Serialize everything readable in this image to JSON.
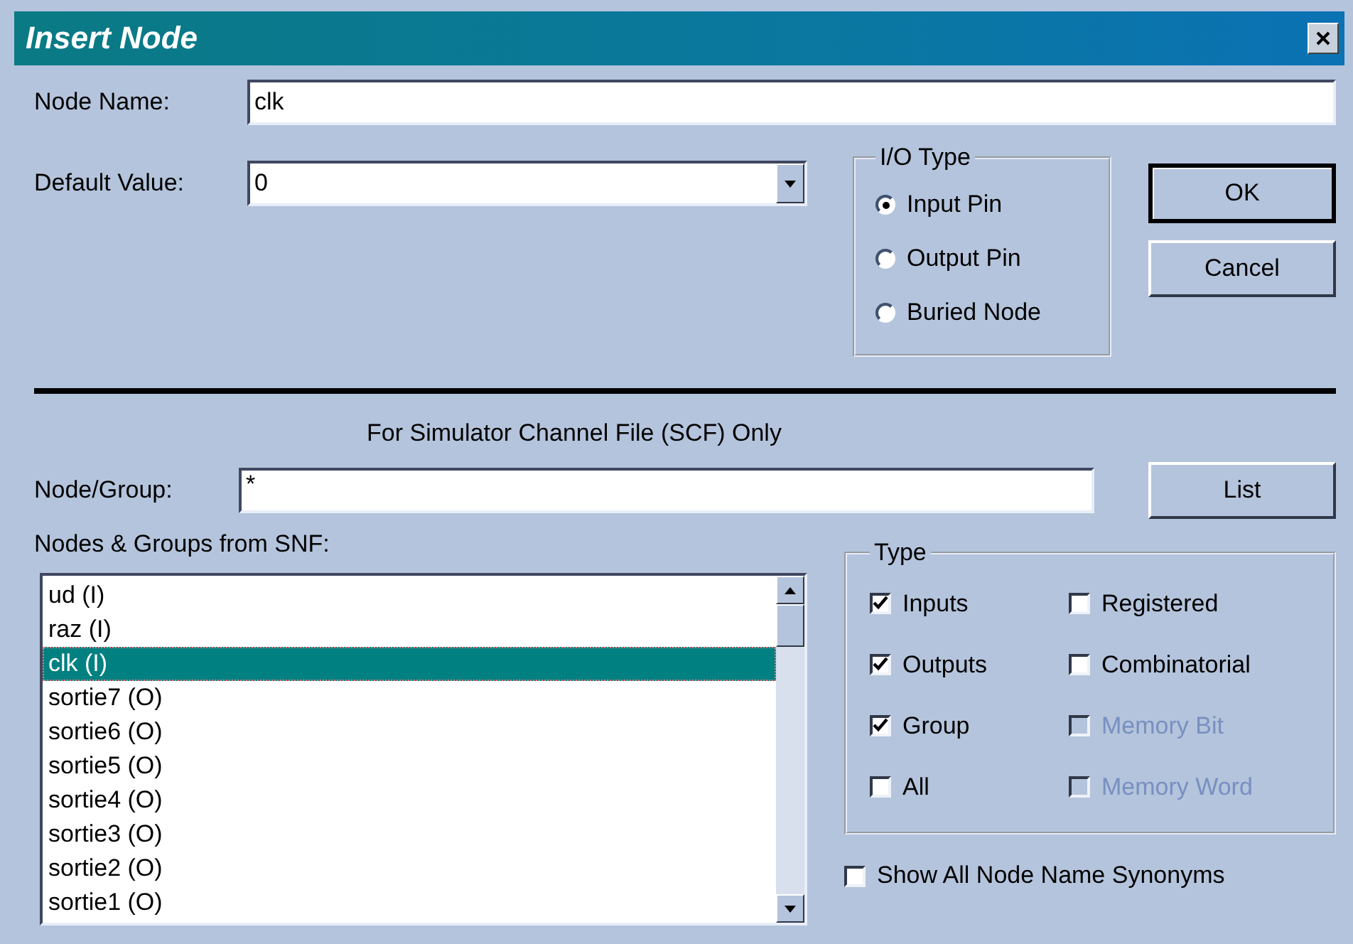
{
  "window": {
    "title": "Insert Node"
  },
  "node_name": {
    "label": "Node Name:",
    "value": "clk"
  },
  "default_value": {
    "label": "Default Value:",
    "value": "0"
  },
  "io_type": {
    "label": "I/O Type",
    "options": [
      {
        "label": "Input Pin",
        "selected": true
      },
      {
        "label": "Output Pin",
        "selected": false
      },
      {
        "label": "Buried Node",
        "selected": false
      }
    ]
  },
  "buttons": [
    {
      "label": "OK",
      "default": true
    },
    {
      "label": "Cancel",
      "default": false
    }
  ],
  "section_caption": "For Simulator Channel File (SCF) Only",
  "node_group": {
    "label": "Node/Group:",
    "value": "*"
  },
  "list_button": {
    "label": "List"
  },
  "nodes_list": {
    "label": "Nodes & Groups from SNF:",
    "items": [
      {
        "label": "ud (I)",
        "selected": false
      },
      {
        "label": "raz (I)",
        "selected": false
      },
      {
        "label": "clk (I)",
        "selected": true
      },
      {
        "label": "sortie7 (O)",
        "selected": false
      },
      {
        "label": "sortie6 (O)",
        "selected": false
      },
      {
        "label": "sortie5 (O)",
        "selected": false
      },
      {
        "label": "sortie4 (O)",
        "selected": false
      },
      {
        "label": "sortie3 (O)",
        "selected": false
      },
      {
        "label": "sortie2 (O)",
        "selected": false
      },
      {
        "label": "sortie1 (O)",
        "selected": false
      }
    ]
  },
  "type_group": {
    "label": "Type",
    "options": [
      {
        "label": "Inputs",
        "checked": true,
        "disabled": false
      },
      {
        "label": "Registered",
        "checked": false,
        "disabled": false
      },
      {
        "label": "Outputs",
        "checked": true,
        "disabled": false
      },
      {
        "label": "Combinatorial",
        "checked": false,
        "disabled": false
      },
      {
        "label": "Group",
        "checked": true,
        "disabled": false
      },
      {
        "label": "Memory Bit",
        "checked": false,
        "disabled": true
      },
      {
        "label": "All",
        "checked": false,
        "disabled": false
      },
      {
        "label": "Memory Word",
        "checked": false,
        "disabled": true
      }
    ]
  },
  "show_synonyms": {
    "label": "Show All Node Name Synonyms",
    "checked": false
  }
}
